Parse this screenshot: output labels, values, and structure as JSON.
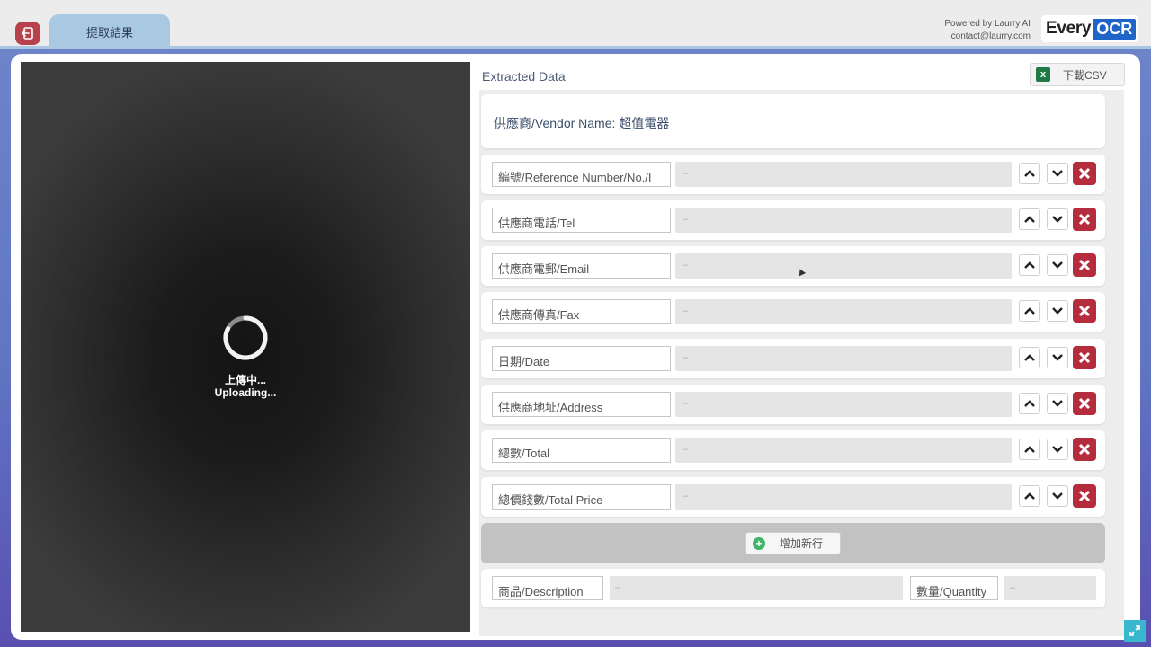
{
  "header": {
    "tab_label": "提取結果",
    "powered_by": "Powered by Laurry AI",
    "contact": "contact@laurry.com",
    "logo_every": "Every",
    "logo_ocr": "OCR"
  },
  "viewer": {
    "status_zh": "上傳中...",
    "status_en": "Uploading..."
  },
  "extracted": {
    "title": "Extracted Data",
    "download_label": "下載CSV",
    "vendor_line": "供應商/Vendor Name: 超值電器",
    "fields": [
      {
        "label": "編號/Reference Number/No./I",
        "value": "–"
      },
      {
        "label": "供應商電話/Tel",
        "value": "–"
      },
      {
        "label": "供應商電郵/Email",
        "value": "–"
      },
      {
        "label": "供應商傳真/Fax",
        "value": "–"
      },
      {
        "label": "日期/Date",
        "value": "–"
      },
      {
        "label": "供應商地址/Address",
        "value": "–"
      },
      {
        "label": "總數/Total",
        "value": "–"
      },
      {
        "label": "總價錢數/Total Price",
        "value": "–"
      }
    ],
    "add_row_label": "增加新行",
    "item": {
      "desc_label": "商品/Description",
      "desc_value": "–",
      "qty_label": "數量/Quantity",
      "qty_value": "–"
    }
  },
  "icons": [
    "exit-icon",
    "excel-icon",
    "chevron-up-icon",
    "chevron-down-icon",
    "close-icon",
    "plus-icon",
    "expand-icon",
    "spinner-icon",
    "cursor-icon"
  ],
  "colors": {
    "accent_tab": "#a9c9e3",
    "delete_red": "#b52d3d",
    "ocr_blue": "#1f65c7",
    "add_green": "#3fb466"
  }
}
